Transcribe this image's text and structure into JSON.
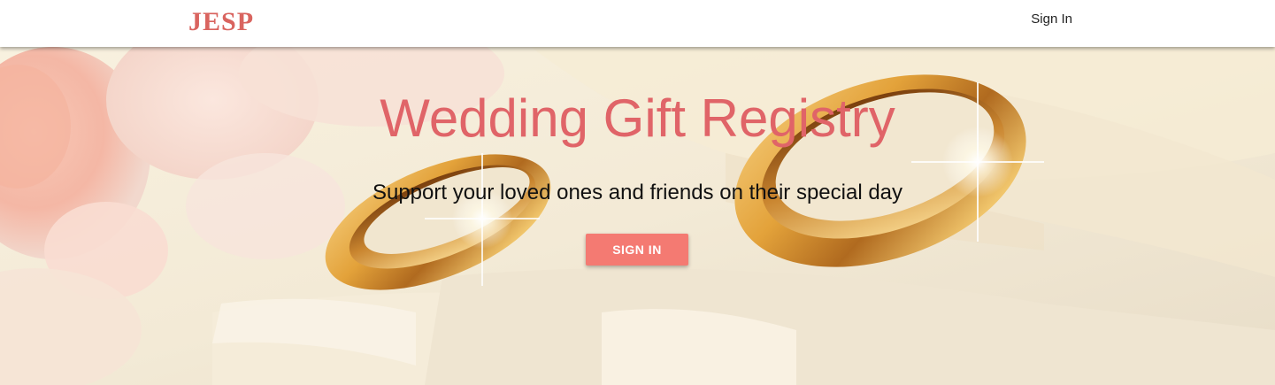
{
  "navbar": {
    "brand": "JESP",
    "signin_link": "Sign In"
  },
  "hero": {
    "title": "Wedding Gift Registry",
    "subtitle": "Support your loved ones and friends on their special day",
    "button_label": "SIGN IN",
    "background_image": "gold-wedding-rings-on-satin-with-roses"
  },
  "colors": {
    "brand": "#d9645f",
    "title": "#e06468",
    "button": "#f47a72"
  }
}
